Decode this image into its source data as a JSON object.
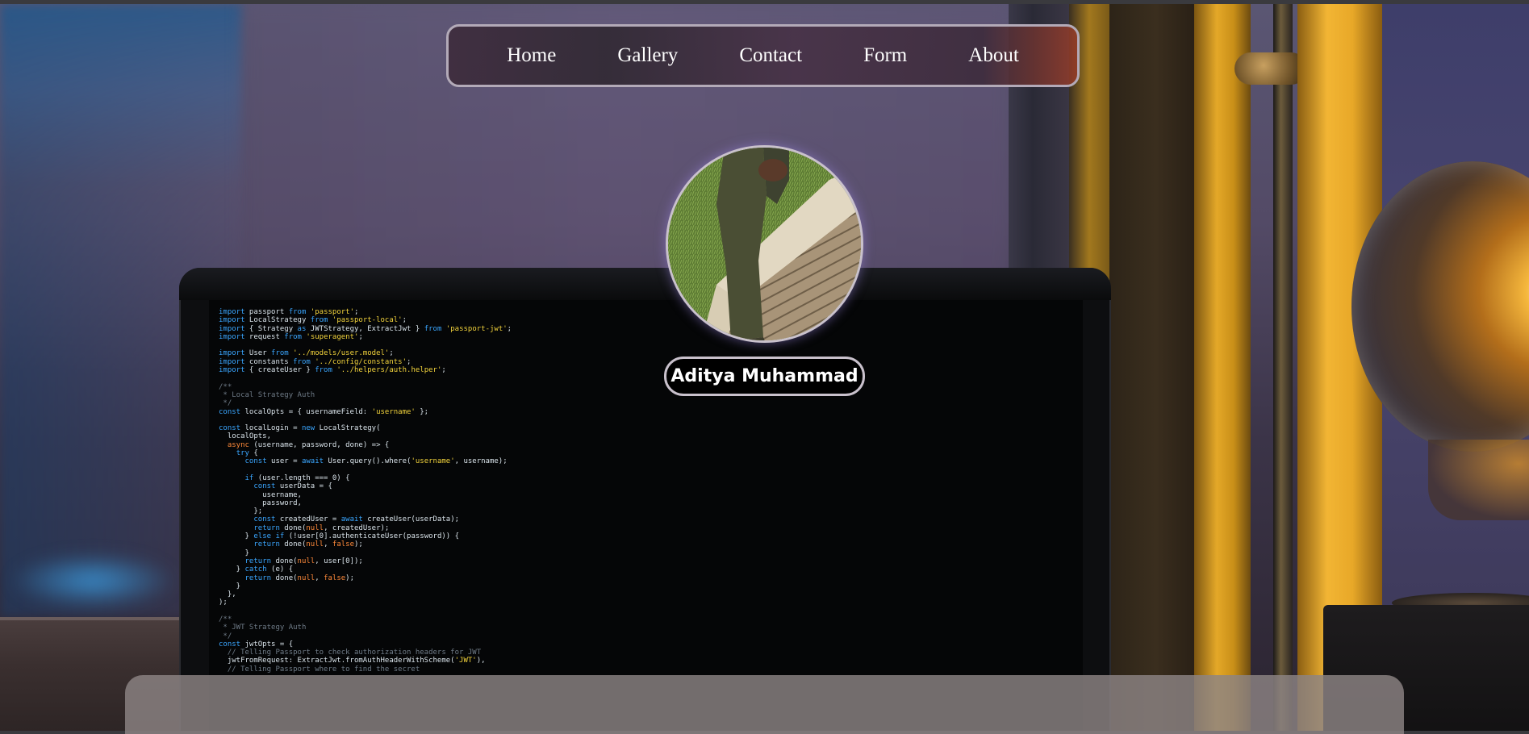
{
  "nav": {
    "items": [
      {
        "label": "Home"
      },
      {
        "label": "Gallery"
      },
      {
        "label": "Contact"
      },
      {
        "label": "Form"
      },
      {
        "label": "About"
      }
    ]
  },
  "profile": {
    "name": "Aditya Muhammad"
  },
  "code_lines": [
    "import passport from 'passport';",
    "import LocalStrategy from 'passport-local';",
    "import { Strategy as JWTStrategy, ExtractJwt } from 'passport-jwt';",
    "import request from 'superagent';",
    "",
    "import User from '../models/user.model';",
    "import constants from '../config/constants';",
    "import { createUser } from '../helpers/auth.helper';",
    "",
    "/**",
    " * Local Strategy Auth",
    " */",
    "const localOpts = { usernameField: 'username' };",
    "",
    "const localLogin = new LocalStrategy(",
    "  localOpts,",
    "  async (username, password, done) => {",
    "    try {",
    "      const user = await User.query().where('username', username);",
    "",
    "      if (user.length === 0) {",
    "        const userData = {",
    "          username,",
    "          password,",
    "        };",
    "        const createdUser = await createUser(userData);",
    "        return done(null, createdUser);",
    "      } else if (!user[0].authenticateUser(password)) {",
    "        return done(null, false);",
    "      }",
    "      return done(null, user[0]);",
    "    } catch (e) {",
    "      return done(null, false);",
    "    }",
    "  },",
    ");",
    "",
    "/**",
    " * JWT Strategy Auth",
    " */",
    "const jwtOpts = {",
    "  // Telling Passport to check authorization headers for JWT",
    "  jwtFromRequest: ExtractJwt.fromAuthHeaderWithScheme('JWT'),",
    "  // Telling Passport where to find the secret"
  ]
}
